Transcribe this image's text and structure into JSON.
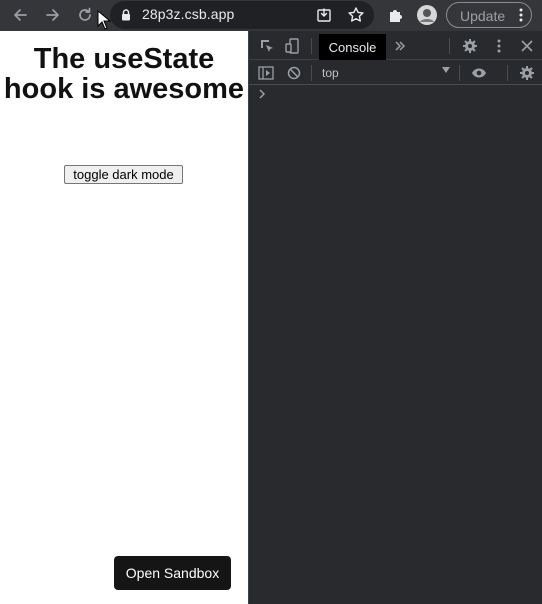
{
  "browser": {
    "url": "28p3z.csb.app",
    "update_label": "Update"
  },
  "page": {
    "heading": "The useState hook is awesome",
    "toggle_button": "toggle dark mode",
    "open_sandbox_button": "Open Sandbox"
  },
  "devtools": {
    "tabs": [
      {
        "label": "Console",
        "active": true
      }
    ],
    "context": "top"
  },
  "colors": {
    "toolbar_bg": "#35363a",
    "omnibox_bg": "#202124",
    "devtools_bg": "#292a2d",
    "page_bg": "#ffffff",
    "sandbox_button_bg": "#151515"
  }
}
